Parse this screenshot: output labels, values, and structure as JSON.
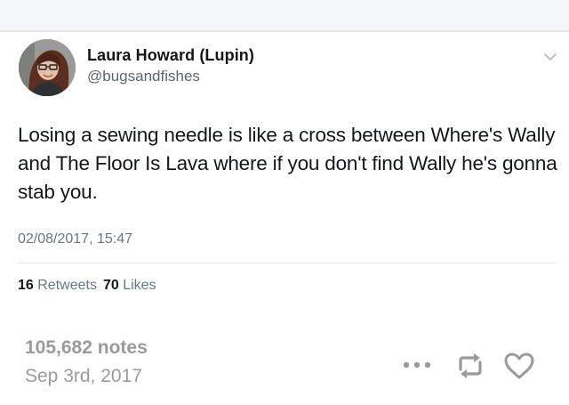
{
  "tweet": {
    "display_name": "Laura Howard (Lupin)",
    "handle": "@bugsandfishes",
    "avatar_icon": "profile-photo",
    "menu_icon": "chevron-down-icon",
    "text": "Losing a sewing needle is like a cross between Where's Wally and The Floor Is Lava where if you don't find Wally he's gonna stab you.",
    "timestamp": "02/08/2017, 15:47",
    "retweets_count": "16",
    "retweets_label": "Retweets",
    "likes_count": "70",
    "likes_label": "Likes"
  },
  "post": {
    "notes": "105,682 notes",
    "date": "Sep 3rd, 2017",
    "actions": [
      {
        "name": "more-options",
        "icon": "ellipsis-icon"
      },
      {
        "name": "reblog",
        "icon": "reblog-icon"
      },
      {
        "name": "like",
        "icon": "heart-icon"
      }
    ]
  },
  "colors": {
    "text_primary": "#14171a",
    "text_secondary": "#657786",
    "post_meta_gray": "#9b9b9b",
    "icon_gray": "#9b9b9b",
    "divider": "#e1e8ed"
  }
}
